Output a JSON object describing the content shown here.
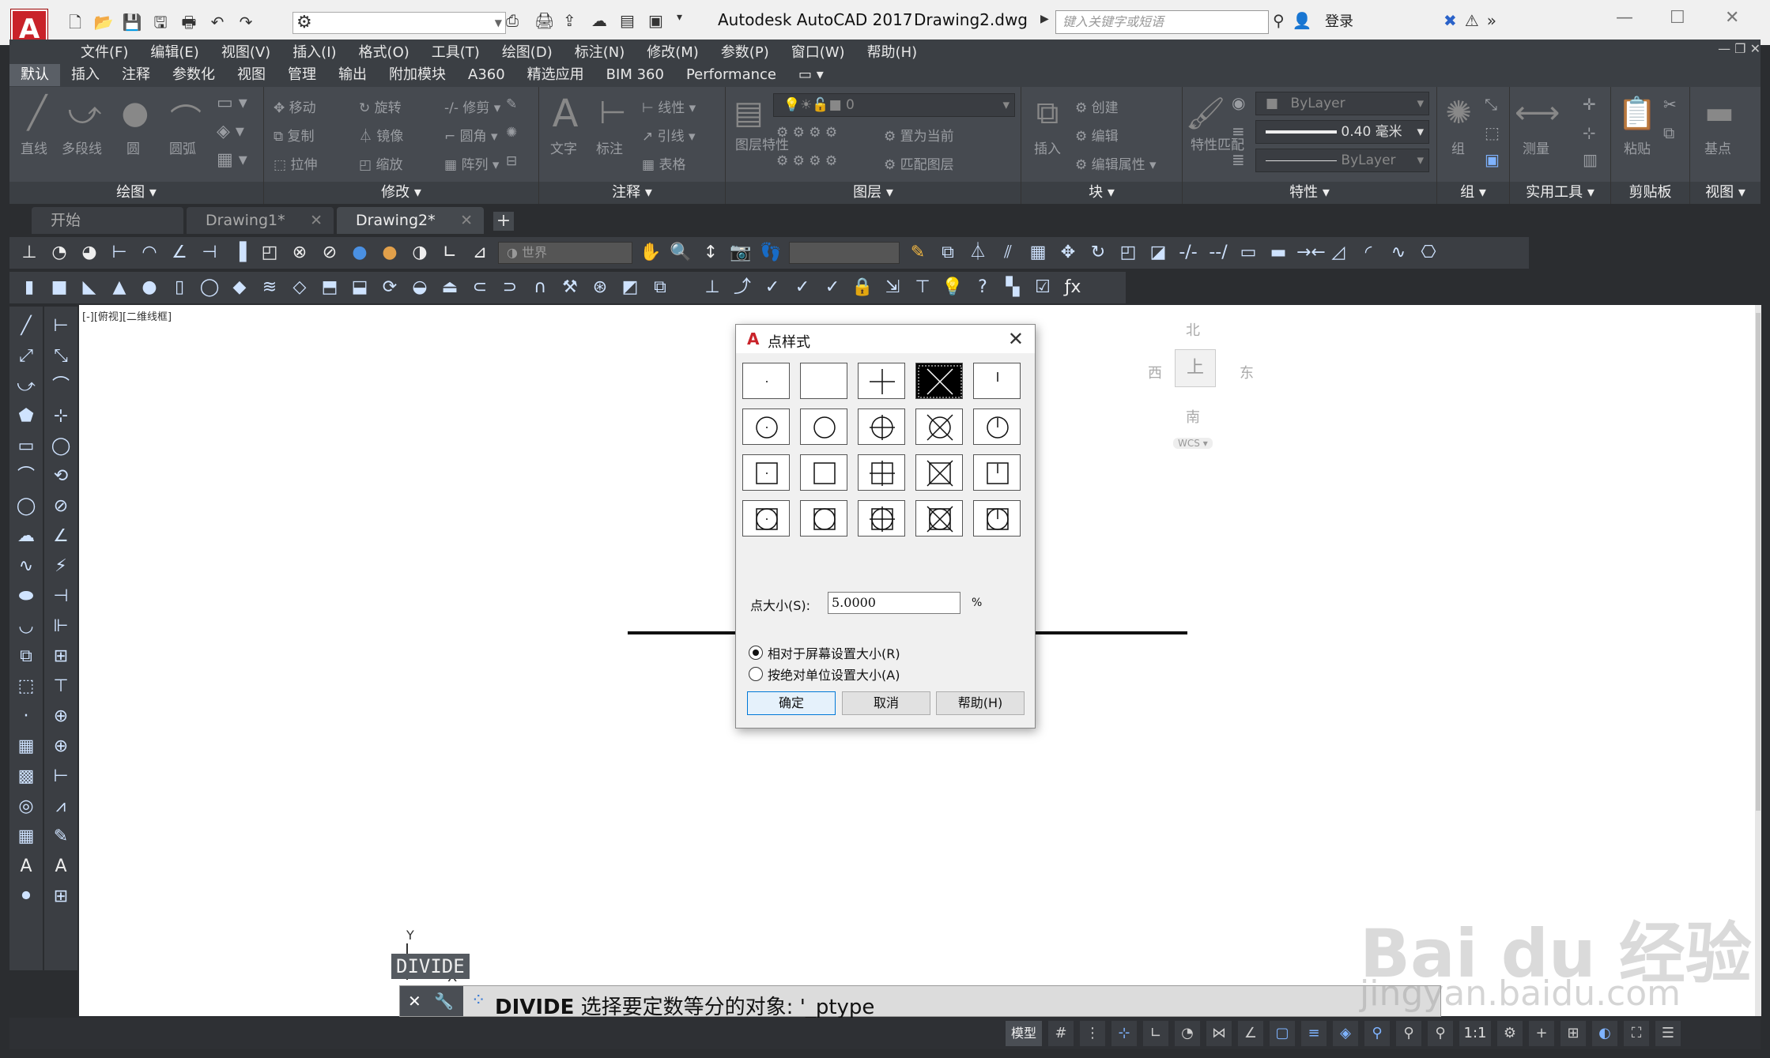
{
  "titlebar": {
    "app_logo": "A",
    "title": "Autodesk AutoCAD 2017",
    "filename": "Drawing2.dwg",
    "search_placeholder": "键入关键字或短语",
    "login": "登录"
  },
  "menu": [
    "文件(F)",
    "编辑(E)",
    "视图(V)",
    "插入(I)",
    "格式(O)",
    "工具(T)",
    "绘图(D)",
    "标注(N)",
    "修改(M)",
    "参数(P)",
    "窗口(W)",
    "帮助(H)"
  ],
  "ribbon_tabs": [
    "默认",
    "插入",
    "注释",
    "参数化",
    "视图",
    "管理",
    "输出",
    "附加模块",
    "A360",
    "精选应用",
    "BIM 360",
    "Performance"
  ],
  "ribbon_panels": {
    "draw": {
      "title": "绘图",
      "tools": [
        "直线",
        "多段线",
        "圆",
        "圆弧"
      ]
    },
    "modify": {
      "title": "修改",
      "tools": [
        "移动",
        "旋转",
        "修剪",
        "复制",
        "镜像",
        "圆角",
        "拉伸",
        "缩放",
        "阵列"
      ]
    },
    "annotate": {
      "title": "注释",
      "tools": [
        "文字",
        "标注",
        "线性",
        "引线",
        "表格"
      ]
    },
    "layers": {
      "title": "图层",
      "layer_name": "0",
      "tools": [
        "图层特性",
        "置为当前",
        "匹配图层"
      ]
    },
    "block": {
      "title": "块",
      "tools": [
        "插入",
        "创建",
        "编辑",
        "编辑属性"
      ]
    },
    "properties": {
      "title": "特性",
      "color": "ByLayer",
      "lineweight": "0.40 毫米",
      "linetype": "ByLayer",
      "tools": [
        "特性匹配"
      ]
    },
    "groups": {
      "title": "组",
      "tools": [
        "组"
      ]
    },
    "utilities": {
      "title": "实用工具",
      "tools": [
        "测量"
      ]
    },
    "clipboard": {
      "title": "剪贴板",
      "tools": [
        "粘贴"
      ]
    },
    "view": {
      "title": "视图",
      "tools": [
        "基点"
      ]
    }
  },
  "doc_tabs": [
    {
      "label": "开始"
    },
    {
      "label": "Drawing1*"
    },
    {
      "label": "Drawing2*"
    }
  ],
  "toolbar": {
    "ucs_combo": "世界"
  },
  "viewport_label": "[-][俯视][二维线框]",
  "viewcube": {
    "north": "北",
    "south": "南",
    "east": "东",
    "west": "西",
    "top": "上",
    "wcs": "WCS"
  },
  "ucs": {
    "y": "Y",
    "x": "X"
  },
  "command": {
    "history": "DIVIDE",
    "current_cmd": "DIVIDE",
    "prompt": "选择要定数等分的对象: '_ptype"
  },
  "statusbar": {
    "model": "模型",
    "scale": "1:1"
  },
  "dialog": {
    "logo": "A",
    "title": "点样式",
    "size_label": "点大小(S):",
    "size_value": "5.0000",
    "size_unit": "%",
    "radio_relative": "相对于屏幕设置大小(R)",
    "radio_absolute": "按绝对单位设置大小(A)",
    "selected_radio": "relative",
    "ok": "确定",
    "cancel": "取消",
    "help": "帮助(H)",
    "selected_style": 3
  },
  "watermark": {
    "main": "Bai du 经验",
    "sub": "jingyan.baidu.com"
  }
}
